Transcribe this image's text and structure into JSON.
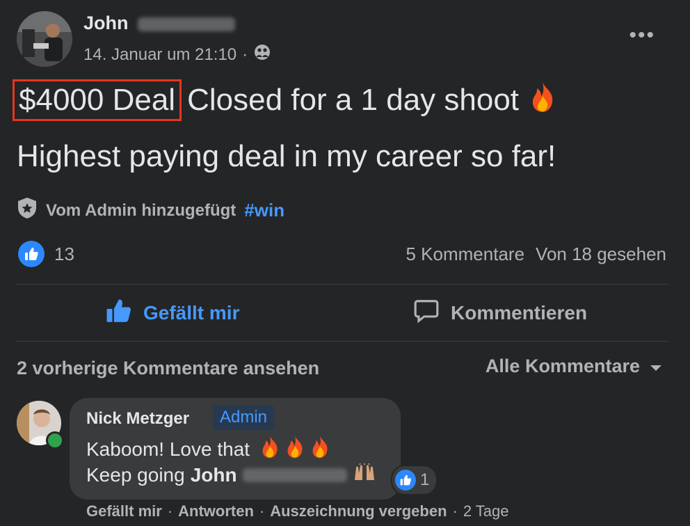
{
  "post": {
    "author_first": "John",
    "timestamp": "14. Januar um 21:10",
    "separator": "·",
    "more_label": "•••",
    "highlight_text": "$4000 Deal",
    "line1_rest": "Closed for a 1 day shoot",
    "line2": "Highest paying deal in my career so far!",
    "admin_note": "Vom Admin hinzugefügt",
    "hashtag": "#win",
    "like_count": "13",
    "comments_count": "5 Kommentare",
    "seen_by": "Von 18 gesehen"
  },
  "actions": {
    "like_label": "Gefällt mir",
    "comment_label": "Kommentieren"
  },
  "comments_header": {
    "previous_label": "2 vorherige Kommentare ansehen",
    "filter_label": "Alle Kommentare"
  },
  "comment": {
    "author": "Nick Metzger",
    "badge": "Admin",
    "line1": "Kaboom! Love that",
    "line2_prefix": "Keep going",
    "line2_name": "John",
    "reaction_count": "1",
    "like_link": "Gefällt mir",
    "reply_link": "Antworten",
    "award_link": "Auszeichnung vergeben",
    "age": "2 Tage",
    "sep": "·"
  },
  "colors": {
    "background": "#242526",
    "accent": "#4599ff",
    "highlight_border": "#e5361f",
    "online": "#31a24c"
  },
  "icons": [
    "more-icon",
    "globe-group-icon",
    "shield-star-icon",
    "like-thumb-icon",
    "comment-bubble-icon",
    "caret-down-icon",
    "fire-emoji",
    "raising-hands-emoji"
  ]
}
